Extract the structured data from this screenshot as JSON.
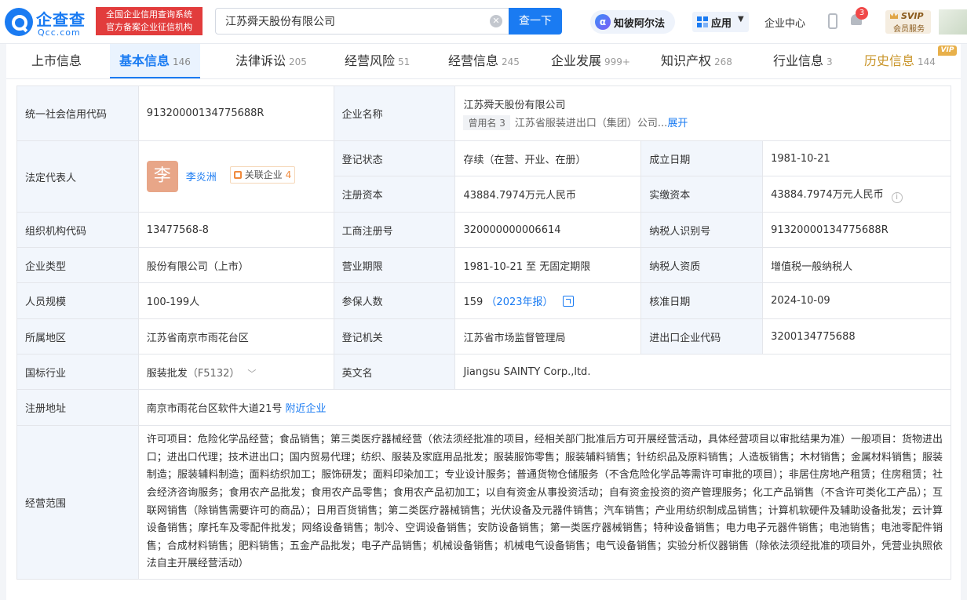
{
  "header": {
    "logo_cn": "企查查",
    "logo_en": "Qcc.com",
    "slogan_line1": "全国企业信用查询系统",
    "slogan_line2": "官方备案企业征信机构",
    "search_value": "江苏舜天股份有限公司",
    "search_button": "查一下",
    "zhibi_label": "知彼阿尔法",
    "app_label": "应用",
    "enterprise_center": "企业中心",
    "notification_count": "3",
    "svip_title": "SVIP",
    "svip_sub": "会员服务"
  },
  "tabs": [
    {
      "label": "上市信息",
      "count": ""
    },
    {
      "label": "基本信息",
      "count": "146"
    },
    {
      "label": "法律诉讼",
      "count": "205"
    },
    {
      "label": "经营风险",
      "count": "51"
    },
    {
      "label": "经营信息",
      "count": "245"
    },
    {
      "label": "企业发展",
      "count": "999+"
    },
    {
      "label": "知识产权",
      "count": "268"
    },
    {
      "label": "行业信息",
      "count": "3"
    },
    {
      "label": "历史信息",
      "count": "144",
      "vip": "VIP"
    }
  ],
  "info": {
    "credit_code_label": "统一社会信用代码",
    "credit_code": "91320000134775688R",
    "company_name_label": "企业名称",
    "company_name": "江苏舜天股份有限公司",
    "former_name_pill": "曾用名 3",
    "former_name": "江苏省服装进出口（集团）公司...",
    "former_expand": "展开",
    "legal_rep_label": "法定代表人",
    "legal_rep_avatar": "李",
    "legal_rep_name": "李炎洲",
    "legal_rep_tag": "关联企业",
    "legal_rep_tag_count": "4",
    "reg_status_label": "登记状态",
    "reg_status": "存续（在营、开业、在册）",
    "founded_label": "成立日期",
    "founded": "1981-10-21",
    "reg_capital_label": "注册资本",
    "reg_capital": "43884.7974万元人民币",
    "paid_capital_label": "实缴资本",
    "paid_capital": "43884.7974万元人民币",
    "org_code_label": "组织机构代码",
    "org_code": "13477568-8",
    "biz_reg_no_label": "工商注册号",
    "biz_reg_no": "320000000006614",
    "taxpayer_id_label": "纳税人识别号",
    "taxpayer_id": "91320000134775688R",
    "company_type_label": "企业类型",
    "company_type": "股份有限公司（上市）",
    "biz_term_label": "营业期限",
    "biz_term": "1981-10-21 至 无固定期限",
    "taxpayer_qual_label": "纳税人资质",
    "taxpayer_qual": "增值税一般纳税人",
    "staff_size_label": "人员规模",
    "staff_size": "100-199人",
    "insured_label": "参保人数",
    "insured": "159",
    "insured_year": "（2023年报）",
    "approved_date_label": "核准日期",
    "approved_date": "2024-10-09",
    "region_label": "所属地区",
    "region": "江苏省南京市雨花台区",
    "reg_authority_label": "登记机关",
    "reg_authority": "江苏省市场监督管理局",
    "ie_code_label": "进出口企业代码",
    "ie_code": "3200134775688",
    "industry_label": "国标行业",
    "industry": "服装批发",
    "industry_code": "（F5132）",
    "english_name_label": "英文名",
    "english_name": "Jiangsu SAINTY Corp.,ltd.",
    "address_label": "注册地址",
    "address": "南京市雨花台区软件大道21号",
    "nearby_link": "附近企业",
    "scope_label": "经营范围",
    "scope": "许可项目：危险化学品经营；食品销售；第三类医疗器械经营（依法须经批准的项目，经相关部门批准后方可开展经营活动，具体经营项目以审批结果为准）一般项目：货物进出口；进出口代理；技术进出口；国内贸易代理；纺织、服装及家庭用品批发；服装服饰零售；服装辅料销售；针纺织品及原料销售；人造板销售；木材销售；金属材料销售；服装制造；服装辅料制造；面料纺织加工；服饰研发；面料印染加工；专业设计服务；普通货物仓储服务（不含危险化学品等需许可审批的项目）；非居住房地产租赁；住房租赁；社会经济咨询服务；食用农产品批发；食用农产品零售；食用农产品初加工；以自有资金从事投资活动；自有资金投资的资产管理服务；化工产品销售（不含许可类化工产品）；互联网销售（除销售需要许可的商品）；日用百货销售；第二类医疗器械销售；光伏设备及元器件销售；汽车销售；产业用纺织制成品销售；计算机软硬件及辅助设备批发；云计算设备销售；摩托车及零配件批发；网络设备销售；制冷、空调设备销售；安防设备销售；第一类医疗器械销售；特种设备销售；电力电子元器件销售；电池销售；电池零配件销售；合成材料销售；肥料销售；五金产品批发；电子产品销售；机械设备销售；机械电气设备销售；电气设备销售；实验分析仪器销售（除依法须经批准的项目外，凭营业执照依法自主开展经营活动）"
  },
  "colors": {
    "brand": "#1a7bf2",
    "label_bg": "#f2f6fc",
    "history": "#c9952a"
  }
}
